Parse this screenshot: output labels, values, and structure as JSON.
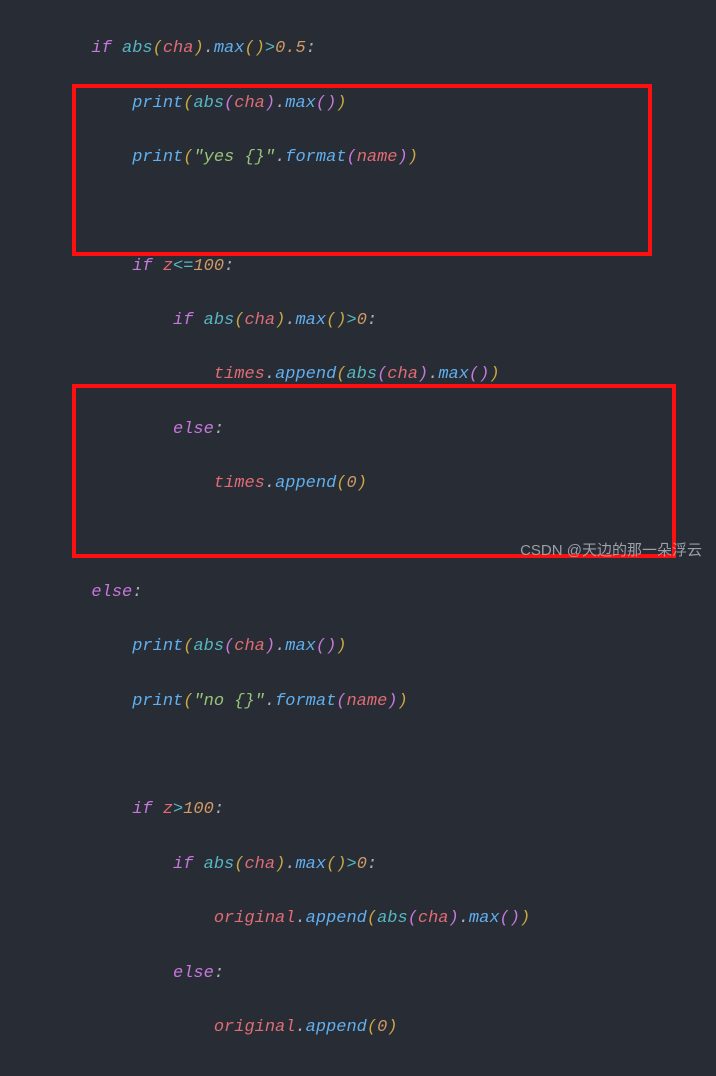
{
  "code": {
    "l1_if": "if",
    "l1_abs": "abs",
    "l1_cha": "cha",
    "l1_max": "max",
    "l1_gt": ">",
    "l1_val": "0.5",
    "l2_print": "print",
    "l2_abs": "abs",
    "l2_cha": "cha",
    "l2_max": "max",
    "l3_print": "print",
    "l3_str": "\"yes {}\"",
    "l3_format": "format",
    "l3_name": "name",
    "l5_if": "if",
    "l5_z": "z",
    "l5_op": "<=",
    "l5_val": "100",
    "l6_if": "if",
    "l6_abs": "abs",
    "l6_cha": "cha",
    "l6_max": "max",
    "l6_gt": ">",
    "l6_val": "0",
    "l7_times": "times",
    "l7_append": "append",
    "l7_abs": "abs",
    "l7_cha": "cha",
    "l7_max": "max",
    "l8_else": "else",
    "l9_times": "times",
    "l9_append": "append",
    "l9_val": "0",
    "l11_else": "else",
    "l12_print": "print",
    "l12_abs": "abs",
    "l12_cha": "cha",
    "l12_max": "max",
    "l13_print": "print",
    "l13_str": "\"no {}\"",
    "l13_format": "format",
    "l13_name": "name",
    "l15_if": "if",
    "l15_z": "z",
    "l15_op": ">",
    "l15_val": "100",
    "l16_if": "if",
    "l16_abs": "abs",
    "l16_cha": "cha",
    "l16_max": "max",
    "l16_gt": ">",
    "l16_val": "0",
    "l17_orig": "original",
    "l17_append": "append",
    "l17_abs": "abs",
    "l17_cha": "cha",
    "l17_max": "max",
    "l18_else": "else",
    "l19_orig": "original",
    "l19_append": "append",
    "l19_val": "0"
  },
  "watermark": "CSDN @天边的那一朵浮云"
}
